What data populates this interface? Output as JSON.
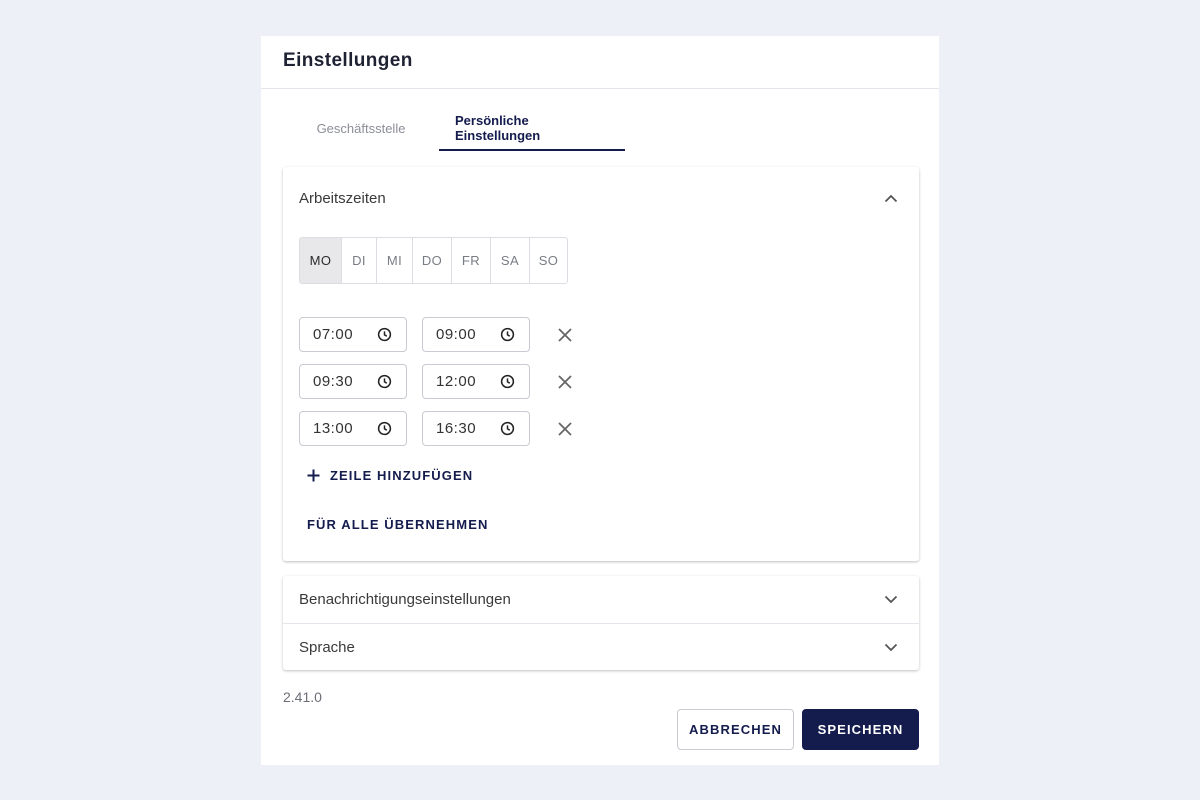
{
  "dialog": {
    "title": "Einstellungen"
  },
  "tabs": [
    {
      "label": "Geschäftsstelle",
      "active": false
    },
    {
      "label": "Persönliche Einstellungen",
      "active": true
    }
  ],
  "work_hours": {
    "title": "Arbeitszeiten",
    "expanded": true,
    "days": [
      {
        "label": "MO",
        "active": true
      },
      {
        "label": "DI",
        "active": false
      },
      {
        "label": "MI",
        "active": false
      },
      {
        "label": "DO",
        "active": false
      },
      {
        "label": "FR",
        "active": false
      },
      {
        "label": "SA",
        "active": false
      },
      {
        "label": "SO",
        "active": false
      }
    ],
    "slots": [
      {
        "from": "07:00",
        "to": "09:00"
      },
      {
        "from": "09:30",
        "to": "12:00"
      },
      {
        "from": "13:00",
        "to": "16:30"
      }
    ],
    "add_row_label": "ZEILE HINZUFÜGEN",
    "apply_all_label": "FÜR ALLE ÜBERNEHMEN"
  },
  "sections": [
    {
      "title": "Benachrichtigungseinstellungen",
      "expanded": false
    },
    {
      "title": "Sprache",
      "expanded": false
    }
  ],
  "version": "2.41.0",
  "actions": {
    "cancel_label": "ABBRECHEN",
    "save_label": "SPEICHERN"
  },
  "colors": {
    "primary": "#141b4d",
    "background": "#edf0f7",
    "active_day": "#e8e8ea"
  },
  "icons": {
    "collapse": "chevron-up-icon",
    "expand": "chevron-down-icon",
    "time": "clock-icon",
    "remove": "close-icon",
    "add": "plus-icon"
  }
}
